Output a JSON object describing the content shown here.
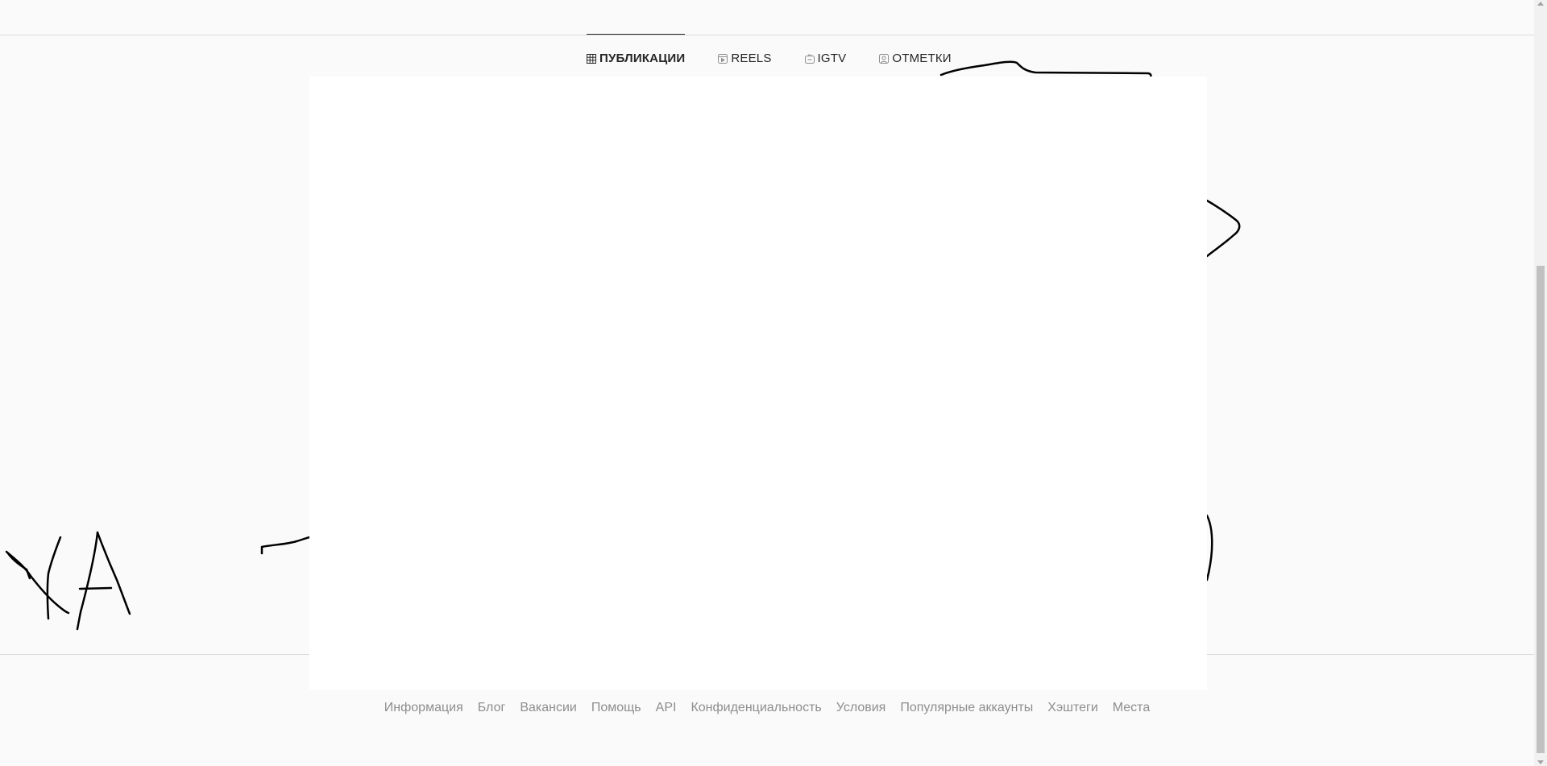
{
  "tabs": [
    {
      "label": "ПУБЛИКАЦИИ",
      "icon": "grid-icon",
      "active": true
    },
    {
      "label": "REELS",
      "icon": "reels-icon",
      "active": false
    },
    {
      "label": "IGTV",
      "icon": "igtv-icon",
      "active": false
    },
    {
      "label": "ОТМЕТКИ",
      "icon": "tagged-icon",
      "active": false
    }
  ],
  "footer": {
    "links": [
      "Информация",
      "Блог",
      "Вакансии",
      "Помощь",
      "API",
      "Конфиденциальность",
      "Условия",
      "Популярные аккаунты",
      "Хэштеги",
      "Места"
    ]
  },
  "colors": {
    "background": "#fafafa",
    "panel": "#ffffff",
    "divider": "#dbdbdb",
    "tab_text": "#262626",
    "footer_text": "#8e8e8e",
    "scribble": "#000000"
  }
}
